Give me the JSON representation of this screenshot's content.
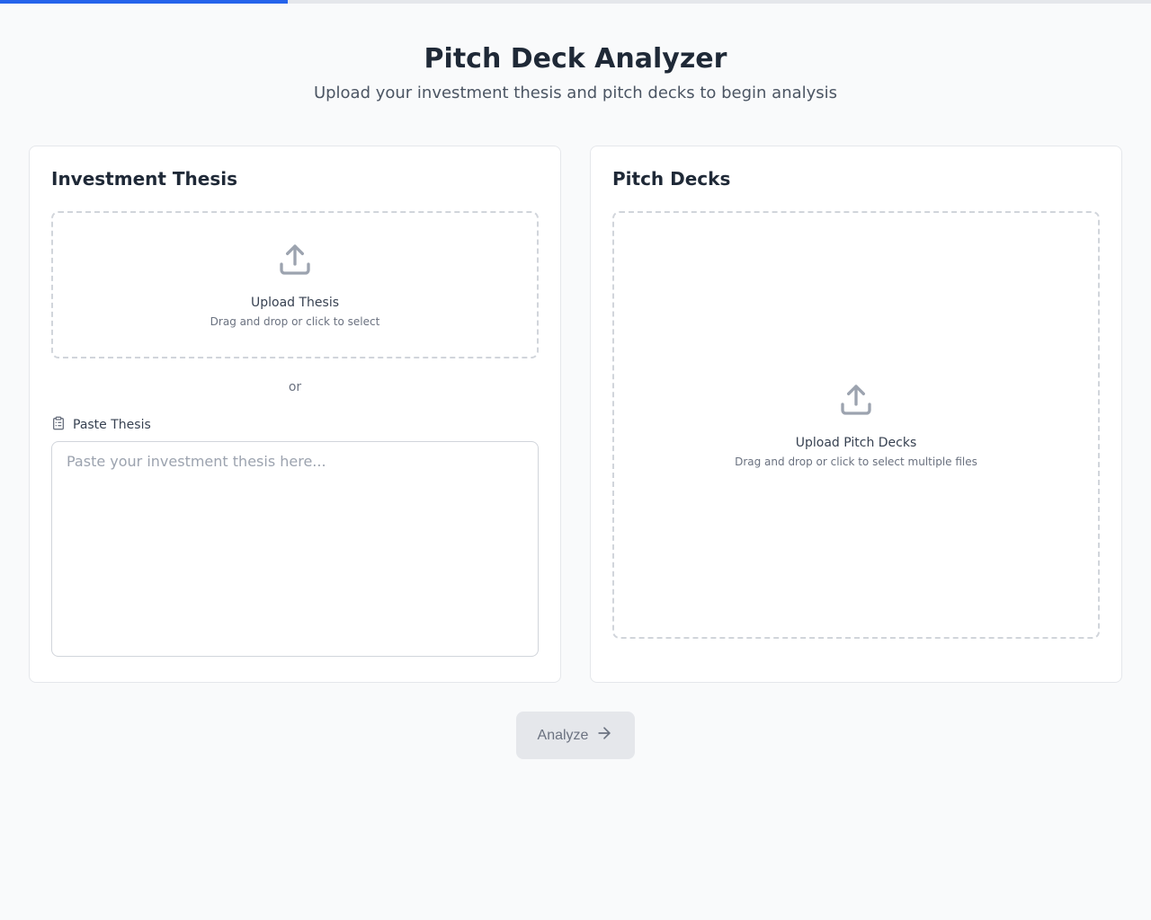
{
  "header": {
    "title": "Pitch Deck Analyzer",
    "subtitle": "Upload your investment thesis and pitch decks to begin analysis"
  },
  "thesis": {
    "card_title": "Investment Thesis",
    "upload_title": "Upload Thesis",
    "upload_hint": "Drag and drop or click to select",
    "or_text": "or",
    "paste_label": "Paste Thesis",
    "textarea_placeholder": "Paste your investment thesis here..."
  },
  "decks": {
    "card_title": "Pitch Decks",
    "upload_title": "Upload Pitch Decks",
    "upload_hint": "Drag and drop or click to select multiple files"
  },
  "analyze": {
    "label": "Analyze"
  }
}
